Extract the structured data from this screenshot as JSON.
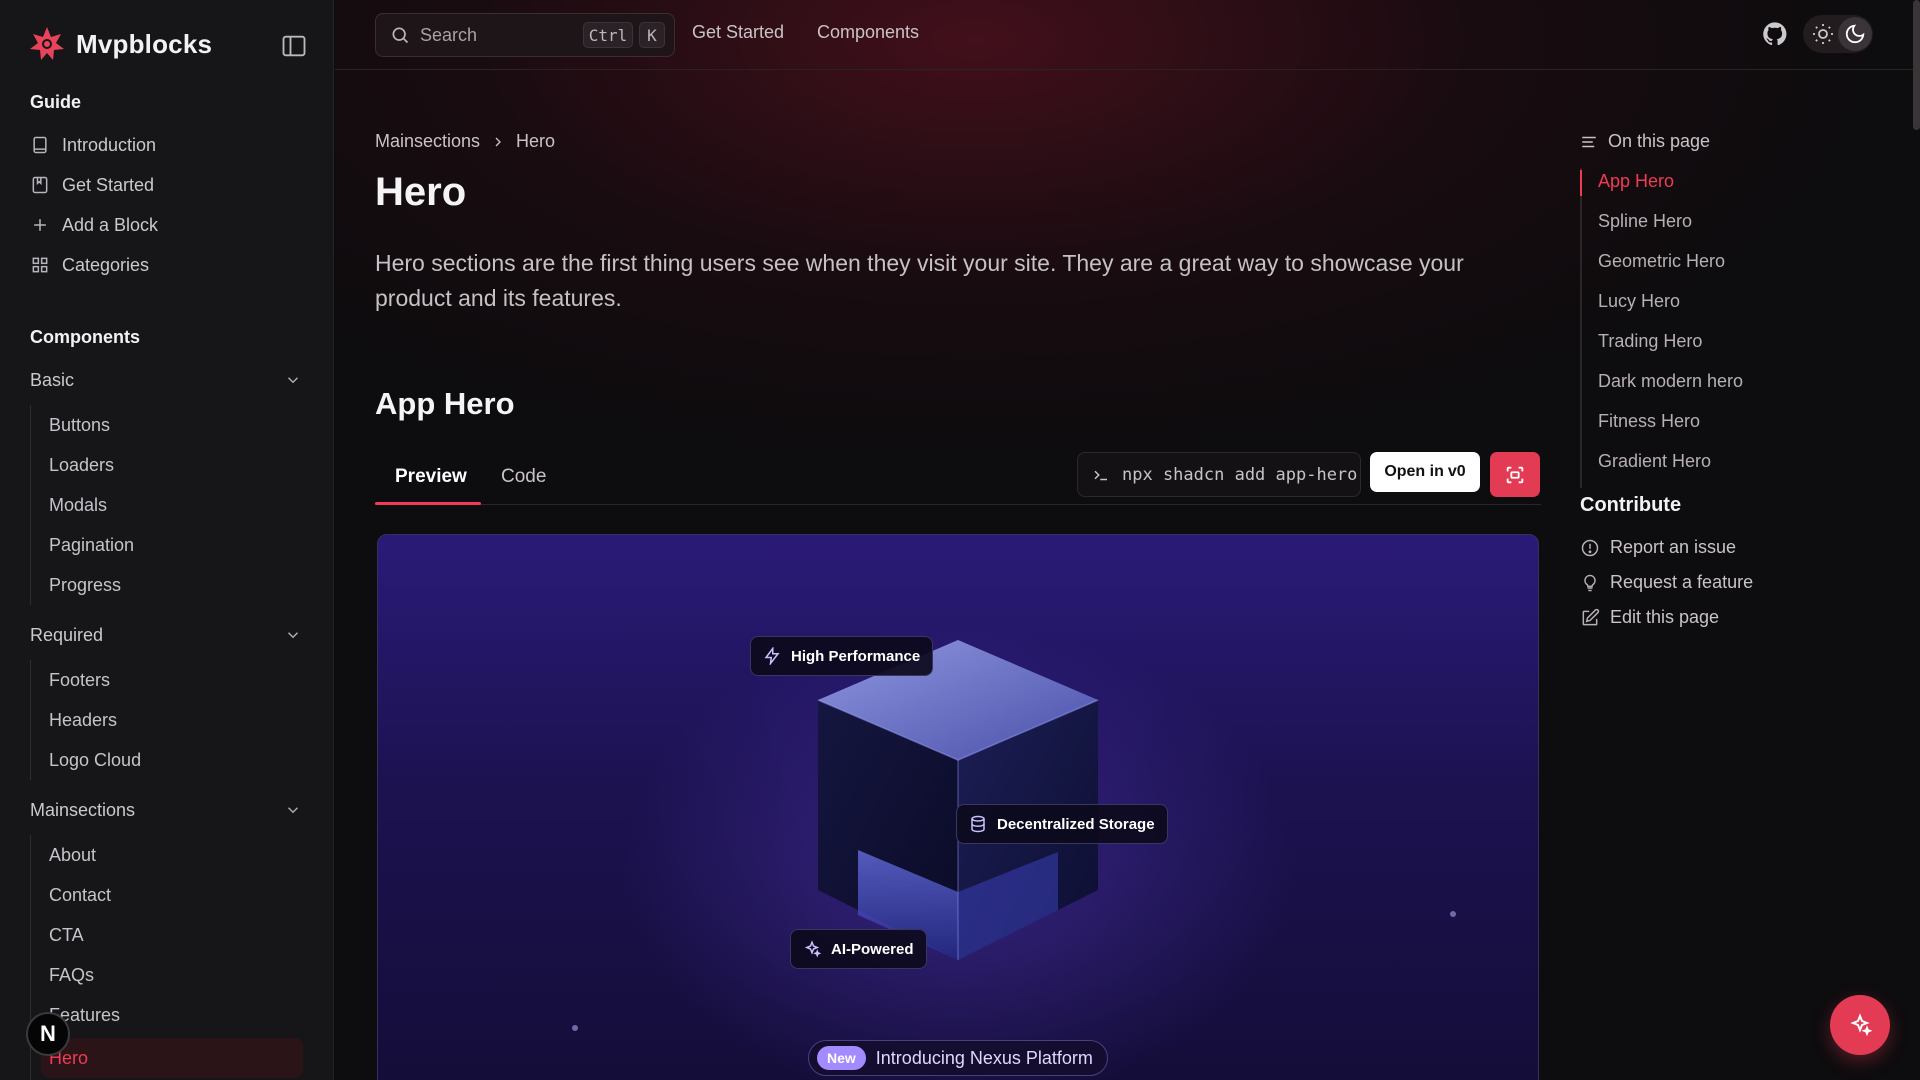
{
  "brand": {
    "name": "Mvpblocks"
  },
  "sidebar": {
    "guide_title": "Guide",
    "guide_items": [
      {
        "label": "Introduction",
        "icon": "book-icon"
      },
      {
        "label": "Get Started",
        "icon": "bookmark-book-icon"
      },
      {
        "label": "Add a Block",
        "icon": "plus-icon"
      },
      {
        "label": "Categories",
        "icon": "grid-icon"
      }
    ],
    "components_title": "Components",
    "groups": [
      {
        "label": "Basic",
        "items": [
          "Buttons",
          "Loaders",
          "Modals",
          "Pagination",
          "Progress"
        ]
      },
      {
        "label": "Required",
        "items": [
          "Footers",
          "Headers",
          "Logo Cloud"
        ]
      },
      {
        "label": "Mainsections",
        "items": [
          "About",
          "Contact",
          "CTA",
          "FAQs",
          "Features",
          "Hero"
        ]
      }
    ],
    "active_item": "Hero",
    "avatar_letter": "N"
  },
  "topbar": {
    "search_placeholder": "Search",
    "shortcut_keys": [
      "Ctrl",
      "K"
    ],
    "links": [
      "Get Started",
      "Components"
    ],
    "icons": [
      "github-icon",
      "sun-icon",
      "moon-icon"
    ]
  },
  "breadcrumb": [
    "Mainsections",
    "Hero"
  ],
  "page": {
    "title": "Hero",
    "lead": "Hero sections are the first thing users see when they visit your site. They are a great way to showcase your product and its features.",
    "section_title": "App Hero"
  },
  "tabs": {
    "preview": "Preview",
    "code": "Code",
    "active": "Preview"
  },
  "actions": {
    "command": "npx shadcn add app-hero",
    "open_in": "Open in",
    "open_in_logo": "v0"
  },
  "preview": {
    "badges": [
      "High Performance",
      "Decentralized Storage",
      "AI-Powered"
    ],
    "announcement_tag": "New",
    "announcement_text": "Introducing Nexus Platform"
  },
  "toc": {
    "heading": "On this page",
    "items": [
      "App Hero",
      "Spline Hero",
      "Geometric Hero",
      "Lucy Hero",
      "Trading Hero",
      "Dark modern hero",
      "Fitness Hero",
      "Gradient Hero"
    ],
    "active": "App Hero"
  },
  "contribute": {
    "title": "Contribute",
    "items": [
      "Report an issue",
      "Request a feature",
      "Edit this page"
    ]
  },
  "colors": {
    "accent": "#ef3b55",
    "sidebar_bg": "#161618",
    "preview_bg": "#1c1250"
  }
}
